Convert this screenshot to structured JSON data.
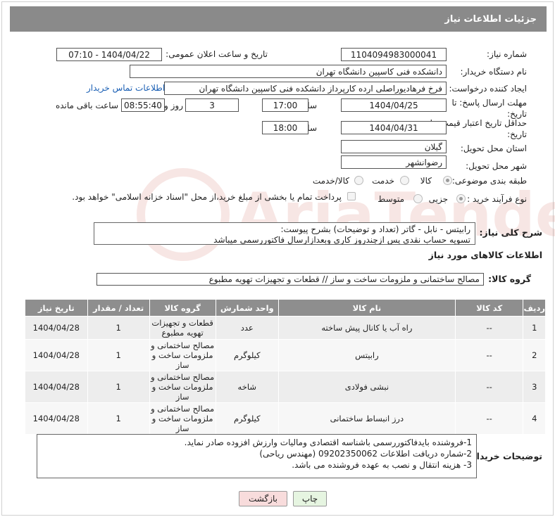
{
  "header": {
    "title": "جزئیات اطلاعات نیاز"
  },
  "form": {
    "need_number_label": "شماره نیاز:",
    "need_number": "1104094983000041",
    "announce_label": "تاریخ و ساعت اعلان عمومی:",
    "announce_value": "1404/04/22 - 07:10",
    "buyer_org_label": "نام دستگاه خریدار:",
    "buyer_org": "دانشکده فنی کاسپین دانشگاه تهران",
    "creator_label": "ایجاد کننده درخواست:",
    "creator": "فرخ فرهادیوراصلی اردە کارپرداز دانشکده فنی کاسپین دانشگاه تهران",
    "contact_link": "اطلاعات تماس خریدار",
    "deadline_label": "مهلت ارسال پاسخ: تا تاریخ:",
    "deadline_date": "1404/04/25",
    "time_label": "ساعت",
    "deadline_time": "17:00",
    "days_value": "3",
    "days_label": "روز و",
    "remaining_time": "08:55:40",
    "remaining_label": "ساعت باقی مانده",
    "validity_label": "حداقل تاریخ اعتبار قیمت: تا تاریخ:",
    "validity_date": "1404/04/31",
    "validity_time": "18:00",
    "province_label": "استان محل تحویل:",
    "province": "گیلان",
    "city_label": "شهر محل تحویل:",
    "city": "رضوانشهر",
    "category_label": "طبقه بندی موضوعی:",
    "category_options": [
      "کالا",
      "خدمت",
      "کالا/خدمت"
    ],
    "purchase_type_label": "نوع فرآیند خرید :",
    "purchase_options": [
      "جزیی",
      "متوسط"
    ],
    "payment_note": "پرداخت تمام یا بخشی از مبلغ خرید،از محل \"اسناد خزانه اسلامی\" خواهد بود."
  },
  "summary": {
    "label": "شرح کلی نیاز:",
    "lines": [
      "رابیتس - نابل - گاتر (تعداد و توضیحات) بشرح پیوست:",
      "تسویه حساب نقدی پس ازچندروز کاری وبعدازارسال فاکتوررسمی میباشد"
    ]
  },
  "goods_info_title": "اطلاعات کالاهای مورد نیاز",
  "goods_group": {
    "label": "گروه کالا:",
    "value": "مصالح ساختمانی و ملزومات ساخت و ساز //  قطعات و تجهیزات تهویه مطبوع"
  },
  "table": {
    "headers": [
      "ردیف",
      "کد کالا",
      "نام کالا",
      "واحد شمارش",
      "گروه کالا",
      "تعداد / مقدار",
      "تاریخ نیاز"
    ],
    "rows": [
      {
        "idx": "1",
        "code": "--",
        "name": "راه آب یا کانال پیش ساخته",
        "unit": "عدد",
        "group": "قطعات و تجهیزات تهویه مطبوع",
        "qty": "1",
        "date": "1404/04/28"
      },
      {
        "idx": "2",
        "code": "--",
        "name": "رابیتس",
        "unit": "کیلوگرم",
        "group": "مصالح ساختمانی و ملزومات ساخت و ساز",
        "qty": "1",
        "date": "1404/04/28"
      },
      {
        "idx": "3",
        "code": "--",
        "name": "نبشی فولادی",
        "unit": "شاخه",
        "group": "مصالح ساختمانی و ملزومات ساخت و ساز",
        "qty": "1",
        "date": "1404/04/28"
      },
      {
        "idx": "4",
        "code": "--",
        "name": "درز انبساط ساختمانی",
        "unit": "کیلوگرم",
        "group": "مصالح ساختمانی و ملزومات ساخت و ساز",
        "qty": "1",
        "date": "1404/04/28"
      }
    ]
  },
  "buyer_notes": {
    "label": "توضیحات خریدار:",
    "lines": [
      "1-فروشنده بایدفاکتوررسمی باشناسه اقتصادی ومالیات وارزش افزوده صادر نماید.",
      "2-شماره دریافت اطلاعات 09202350062 (مهندس ریاحی)",
      "3- هزینه انتقال و نصب به عهده فروشنده می باشد."
    ]
  },
  "buttons": {
    "print": "چاپ",
    "back": "بازگشت"
  },
  "colors": {
    "header_bg": "#8a8a8a",
    "link": "#1a5fb4",
    "back_button_bg": "#f8dcdc",
    "print_button_bg": "#e6f5e1"
  }
}
